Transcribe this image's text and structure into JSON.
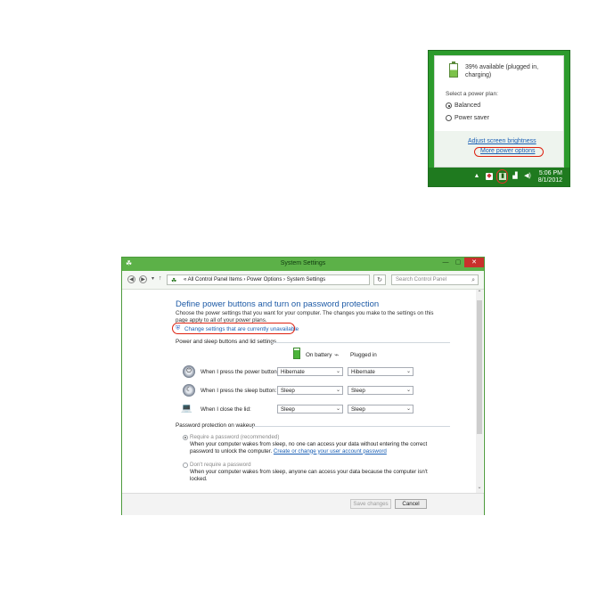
{
  "battery_flyout": {
    "status": "39% available (plugged in, charging)",
    "select_plan_label": "Select a power plan:",
    "plans": [
      {
        "label": "Balanced",
        "selected": true
      },
      {
        "label": "Power saver",
        "selected": false
      }
    ],
    "adjust_brightness_link": "Adjust screen brightness",
    "more_power_options_link": "More power options",
    "taskbar": {
      "up_arrow": "▲",
      "time": "5:06 PM",
      "date": "8/1/2012"
    }
  },
  "window": {
    "title": "System Settings",
    "controls": {
      "minimize": "—",
      "maximize": "▢",
      "close": "✕"
    },
    "address": {
      "back": "◀",
      "forward": "▶",
      "up": "↑",
      "path": "« All Control Panel Items  ›  Power Options  ›  System Settings",
      "refresh": "↻",
      "search_placeholder": "Search Control Panel"
    },
    "heading": "Define power buttons and turn on password protection",
    "description": "Choose the power settings that you want for your computer. The changes you make to the settings on this page apply to all of your power plans.",
    "change_settings_link": "Change settings that are currently unavailable",
    "section_power": "Power and sleep buttons and lid settings",
    "columns": {
      "on_battery": "On battery",
      "plugged_in": "Plugged in"
    },
    "rows": [
      {
        "label": "When I press the power button:",
        "on_battery": "Hibernate",
        "plugged_in": "Hibernate"
      },
      {
        "label": "When I press the sleep button:",
        "on_battery": "Sleep",
        "plugged_in": "Sleep"
      },
      {
        "label": "When I close the lid:",
        "on_battery": "Sleep",
        "plugged_in": "Sleep"
      }
    ],
    "section_password": "Password protection on wakeup",
    "require_password": {
      "label": "Require a password (recommended)",
      "text": "When your computer wakes from sleep, no one can access your data without entering the correct password to unlock the computer.",
      "link": "Create or change your user account password"
    },
    "no_password": {
      "label": "Don't require a password",
      "text": "When your computer wakes from sleep, anyone can access your data because the computer isn't locked."
    },
    "buttons": {
      "save": "Save changes",
      "cancel": "Cancel"
    }
  },
  "colors": {
    "taskbar_green": "#1f7a1f",
    "titlebar_green": "#5cb148",
    "highlight_red": "#d21f1f",
    "link_blue": "#1a5fb4"
  }
}
